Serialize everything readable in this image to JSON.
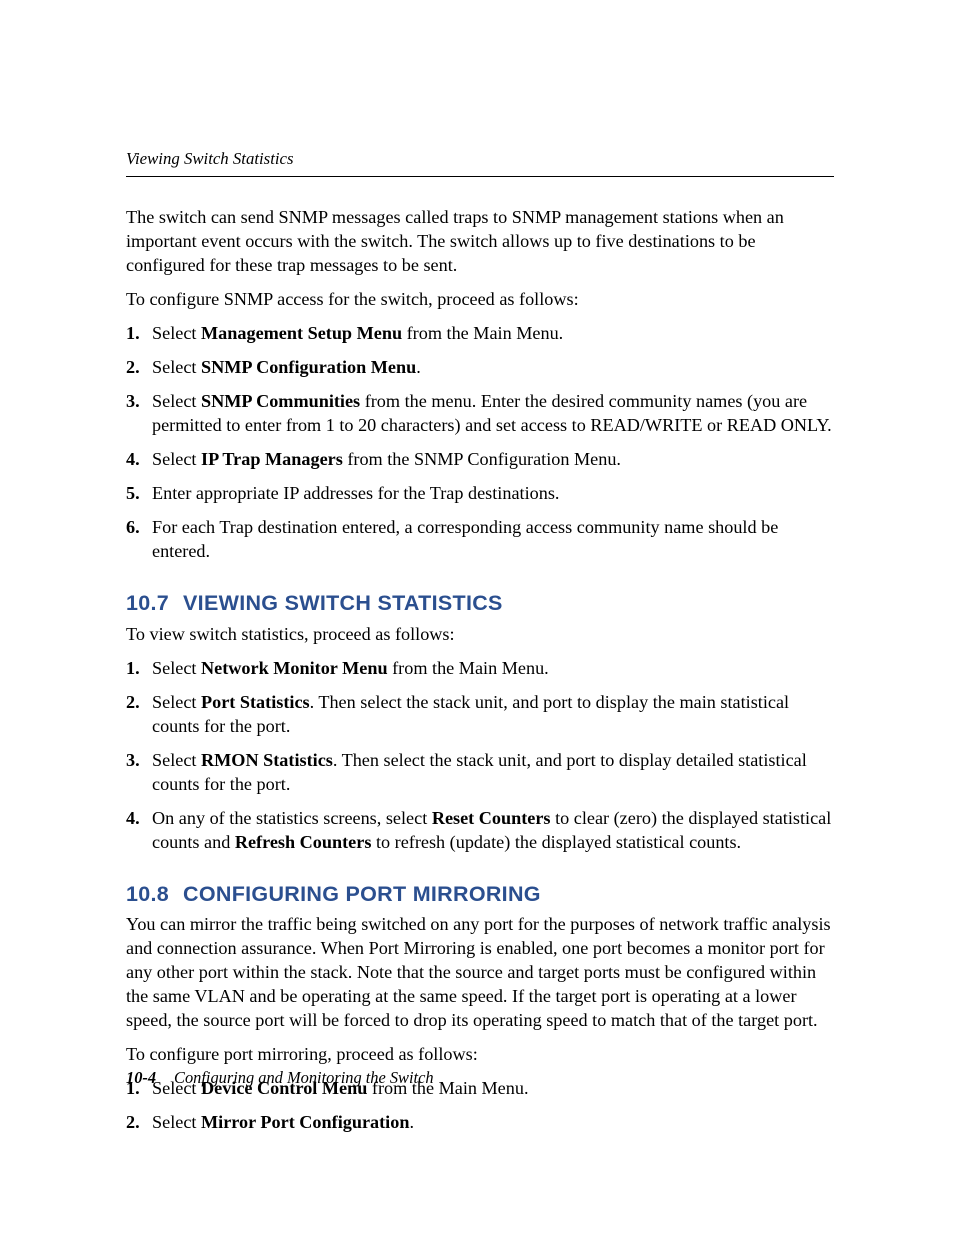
{
  "running_head": "Viewing Switch Statistics",
  "intro_para": "The switch can send SNMP messages called traps to SNMP management stations when an important event occurs with the switch. The switch allows up to five destinations to be configured for these trap messages to be sent.",
  "intro_lead": "To configure SNMP access for the switch, proceed as follows:",
  "intro_steps": [
    {
      "n": "1.",
      "pre": "Select ",
      "bold": "Management Setup Menu",
      "post": " from the Main Menu."
    },
    {
      "n": "2.",
      "pre": "Select ",
      "bold": "SNMP Configuration Menu",
      "post": "."
    },
    {
      "n": "3.",
      "pre": "Select ",
      "bold": "SNMP Communities",
      "post": " from the menu. Enter the desired community names (you are permitted to enter from 1 to 20 characters) and set access to READ/WRITE or READ ONLY."
    },
    {
      "n": "4.",
      "pre": "Select ",
      "bold": "IP Trap Managers",
      "post": " from the SNMP Configuration Menu."
    },
    {
      "n": "5.",
      "pre": "",
      "bold": "",
      "post": "Enter appropriate IP addresses for the Trap destinations."
    },
    {
      "n": "6.",
      "pre": "",
      "bold": "",
      "post": "For each Trap destination entered, a corresponding access community name should be entered."
    }
  ],
  "sec107": {
    "num": "10.7",
    "title": "VIEWING SWITCH STATISTICS",
    "lead": "To view switch statistics, proceed as follows:",
    "steps": [
      {
        "n": "1.",
        "pre": "Select ",
        "bold": "Network Monitor Menu",
        "post": " from the Main Menu."
      },
      {
        "n": "2.",
        "pre": "Select ",
        "bold": "Port Statistics",
        "post": ". Then select the stack unit, and port to display the main statistical counts for the port."
      },
      {
        "n": "3.",
        "pre": "Select ",
        "bold": "RMON Statistics",
        "post": ". Then select the stack unit, and port to display detailed statistical counts for the port."
      }
    ],
    "step4": {
      "n": "4.",
      "t1": "On any of the statistics screens, select ",
      "b1": "Reset Counters",
      "t2": " to clear (zero) the displayed statistical counts and ",
      "b2": "Refresh Counters",
      "t3": " to refresh (update) the displayed statistical counts."
    }
  },
  "sec108": {
    "num": "10.8",
    "title": "CONFIGURING PORT MIRRORING",
    "para": "You can mirror the traffic being switched on any port for the purposes of network traffic analysis and connection assurance. When Port Mirroring is enabled, one port becomes a monitor port for any other port within the stack. Note that the source and target ports must be configured within the same VLAN and be operating at the same speed. If the target port is operating at a lower speed, the source port will be forced to drop its operating speed to match that of the target port.",
    "lead": "To configure port mirroring, proceed as follows:",
    "steps": [
      {
        "n": "1.",
        "pre": "Select ",
        "bold": "Device Control Menu",
        "post": " from the Main Menu."
      },
      {
        "n": "2.",
        "pre": "Select ",
        "bold": "Mirror Port Configuration",
        "post": "."
      }
    ]
  },
  "footer": {
    "pageno": "10-4",
    "title": "Configuring and Monitoring the Switch"
  }
}
